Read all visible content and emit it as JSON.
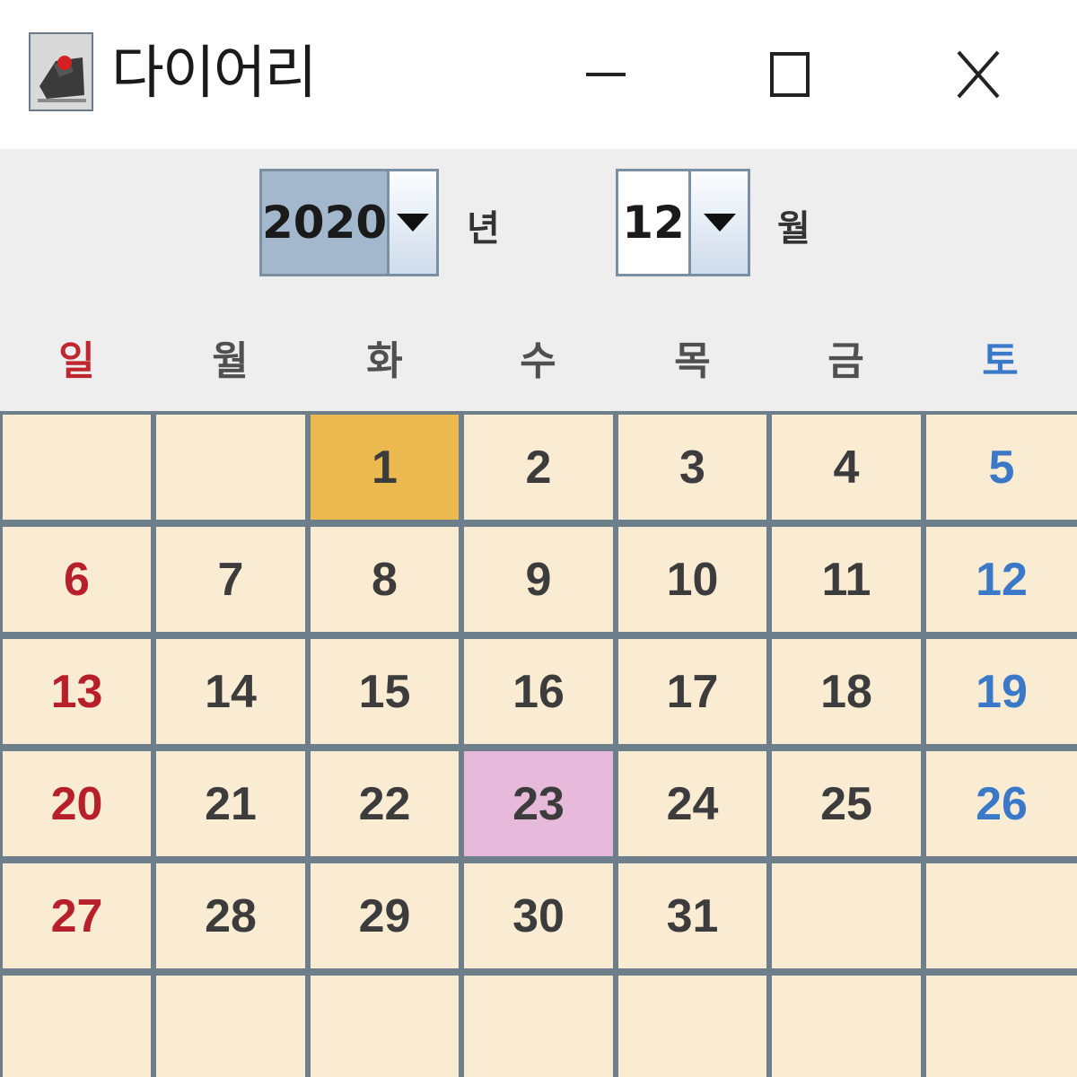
{
  "window": {
    "title": "다이어리"
  },
  "year_combo": {
    "value": "2020",
    "unit": "년"
  },
  "month_combo": {
    "value": "12",
    "unit": "월"
  },
  "weekdays": [
    "일",
    "월",
    "화",
    "수",
    "목",
    "금",
    "토"
  ],
  "weeks": [
    [
      "",
      "",
      "1",
      "2",
      "3",
      "4",
      "5"
    ],
    [
      "6",
      "7",
      "8",
      "9",
      "10",
      "11",
      "12"
    ],
    [
      "13",
      "14",
      "15",
      "16",
      "17",
      "18",
      "19"
    ],
    [
      "20",
      "21",
      "22",
      "23",
      "24",
      "25",
      "26"
    ],
    [
      "27",
      "28",
      "29",
      "30",
      "31",
      "",
      ""
    ],
    [
      "",
      "",
      "",
      "",
      "",
      "",
      ""
    ]
  ],
  "highlighted_today": "1",
  "highlighted_selected": "23",
  "colors": {
    "sunday": "#b71f2a",
    "saturday": "#3a78c8",
    "cell_bg": "#faecd3",
    "today_bg": "#ebb94f",
    "selected_bg": "#e7b9da",
    "grid_line": "#6e7f8c"
  }
}
